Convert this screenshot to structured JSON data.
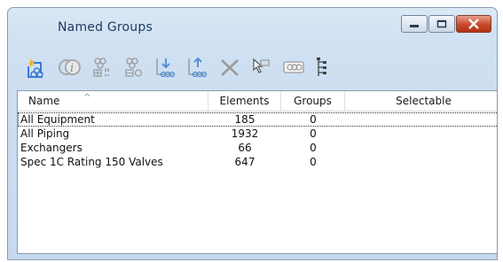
{
  "window": {
    "title": "Named Groups"
  },
  "toolbar": {
    "buttons": [
      {
        "name": "new-group-icon"
      },
      {
        "name": "info-icon"
      },
      {
        "name": "add-group-icon"
      },
      {
        "name": "remove-group-icon"
      },
      {
        "name": "add-elements-icon"
      },
      {
        "name": "remove-elements-icon"
      },
      {
        "name": "delete-icon"
      },
      {
        "name": "select-pointer-icon"
      },
      {
        "name": "properties-icon"
      },
      {
        "name": "tree-view-icon"
      }
    ]
  },
  "list": {
    "columns": [
      {
        "label": "Name"
      },
      {
        "label": "Elements"
      },
      {
        "label": "Groups"
      },
      {
        "label": "Selectable"
      }
    ],
    "sort_indicator": "^",
    "rows": [
      {
        "name": "All Equipment",
        "elements": "185",
        "groups": "0",
        "selectable": ""
      },
      {
        "name": "All Piping",
        "elements": "1932",
        "groups": "0",
        "selectable": ""
      },
      {
        "name": "Exchangers",
        "elements": "66",
        "groups": "0",
        "selectable": ""
      },
      {
        "name": "Spec 1C Rating 150 Valves",
        "elements": "647",
        "groups": "0",
        "selectable": ""
      }
    ]
  },
  "colors": {
    "title_text": "#1e3a5f",
    "close_button": "#c9482c",
    "icon_blue": "#3a7bd5",
    "icon_gray": "#8a8a8a"
  }
}
